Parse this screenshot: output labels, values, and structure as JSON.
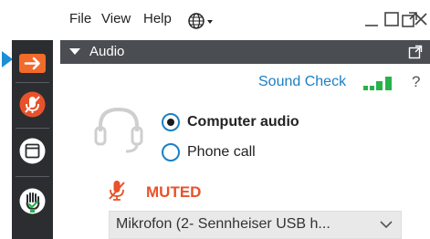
{
  "menu": {
    "file": "File",
    "view": "View",
    "help": "Help",
    "language_icon": "globe-icon"
  },
  "window": {
    "minimize_icon": "minimize-icon",
    "maximize_icon": "maximize-icon",
    "popout_icon": "popout-icon",
    "close_icon": "close-icon"
  },
  "sidebar": {
    "items": [
      {
        "icon": "arrow-right-icon",
        "color": "#f26b2a"
      },
      {
        "icon": "mic-muted-icon",
        "color": "#e8522a"
      },
      {
        "icon": "window-icon",
        "color": "#ffffff"
      },
      {
        "icon": "hand-icon",
        "color": "#ffffff"
      }
    ]
  },
  "panel": {
    "title": "Audio",
    "sound_check": "Sound Check",
    "help_mark": "?",
    "options": [
      {
        "label": "Computer audio",
        "selected": true
      },
      {
        "label": "Phone call",
        "selected": false
      }
    ],
    "mute_status": "MUTED",
    "device": "Mikrofon (2- Sennheiser USB h..."
  },
  "colors": {
    "accent": "#1b7fc4",
    "muted": "#e8522a",
    "meter": "#27b24a",
    "sidebar": "#2b2d30",
    "header": "#4a4d52"
  }
}
